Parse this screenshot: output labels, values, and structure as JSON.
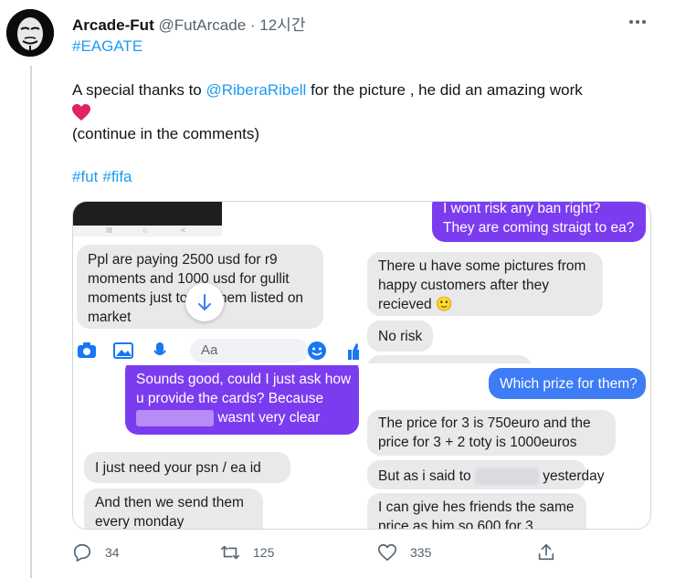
{
  "tweet": {
    "display_name": "Arcade-Fut",
    "handle": "@FutArcade",
    "separator": " · ",
    "time": "12시간",
    "hashtag_top": "#EAGATE",
    "line1_before": "A special thanks to ",
    "line1_mention": "@RiberaRibell",
    "line1_after": " for the picture , he did an amazing work",
    "line2": "(continue in the comments)",
    "tags": [
      "#fut",
      "#fifa"
    ]
  },
  "media": {
    "q1": {
      "bubble": [
        "Ppl are paying 2500 usd for r9",
        "moments and 1000 usd for gullit",
        "moments just to get them listed on",
        "market"
      ],
      "input_placeholder": "Aa"
    },
    "q2": {
      "out_bubble": [
        "I wont risk any ban right?",
        "They are coming straigt to ea?"
      ],
      "in_bubble": [
        "There u have some pictures from",
        "happy customers after they",
        "recieved 🙂"
      ],
      "no_risk": "No risk"
    },
    "q3": {
      "out_line1": "Sounds good, could I just ask how",
      "out_line2": "u provide the cards? Because",
      "out_line3_after": "wasnt very clear",
      "in1": "I just need your psn / ea id",
      "in2": [
        "And then we send them",
        "every monday"
      ]
    },
    "q4": {
      "out": "Which prize for them?",
      "in1": [
        "The price for 3 is 750euro and the",
        "price for 3 + 2 toty is 1000euros"
      ],
      "in2_before": "But as i said to",
      "in2_after": "yesterday",
      "in3": [
        "I can give hes friends the same",
        "price as him so 600 for 3"
      ]
    }
  },
  "actions": {
    "reply_count": "34",
    "retweet_count": "125",
    "like_count": "335"
  },
  "colors": {
    "accent": "#1d9bf0",
    "heart": "#e0245e",
    "purple": "#7b3cf0",
    "blue": "#3d7cf5"
  },
  "icons": [
    "avatar-mask",
    "more-icon",
    "heart-emoji",
    "reply-icon",
    "retweet-icon",
    "like-icon",
    "share-icon",
    "camera-icon",
    "image-icon",
    "mic-icon",
    "emoji-icon",
    "scroll-down-icon"
  ]
}
